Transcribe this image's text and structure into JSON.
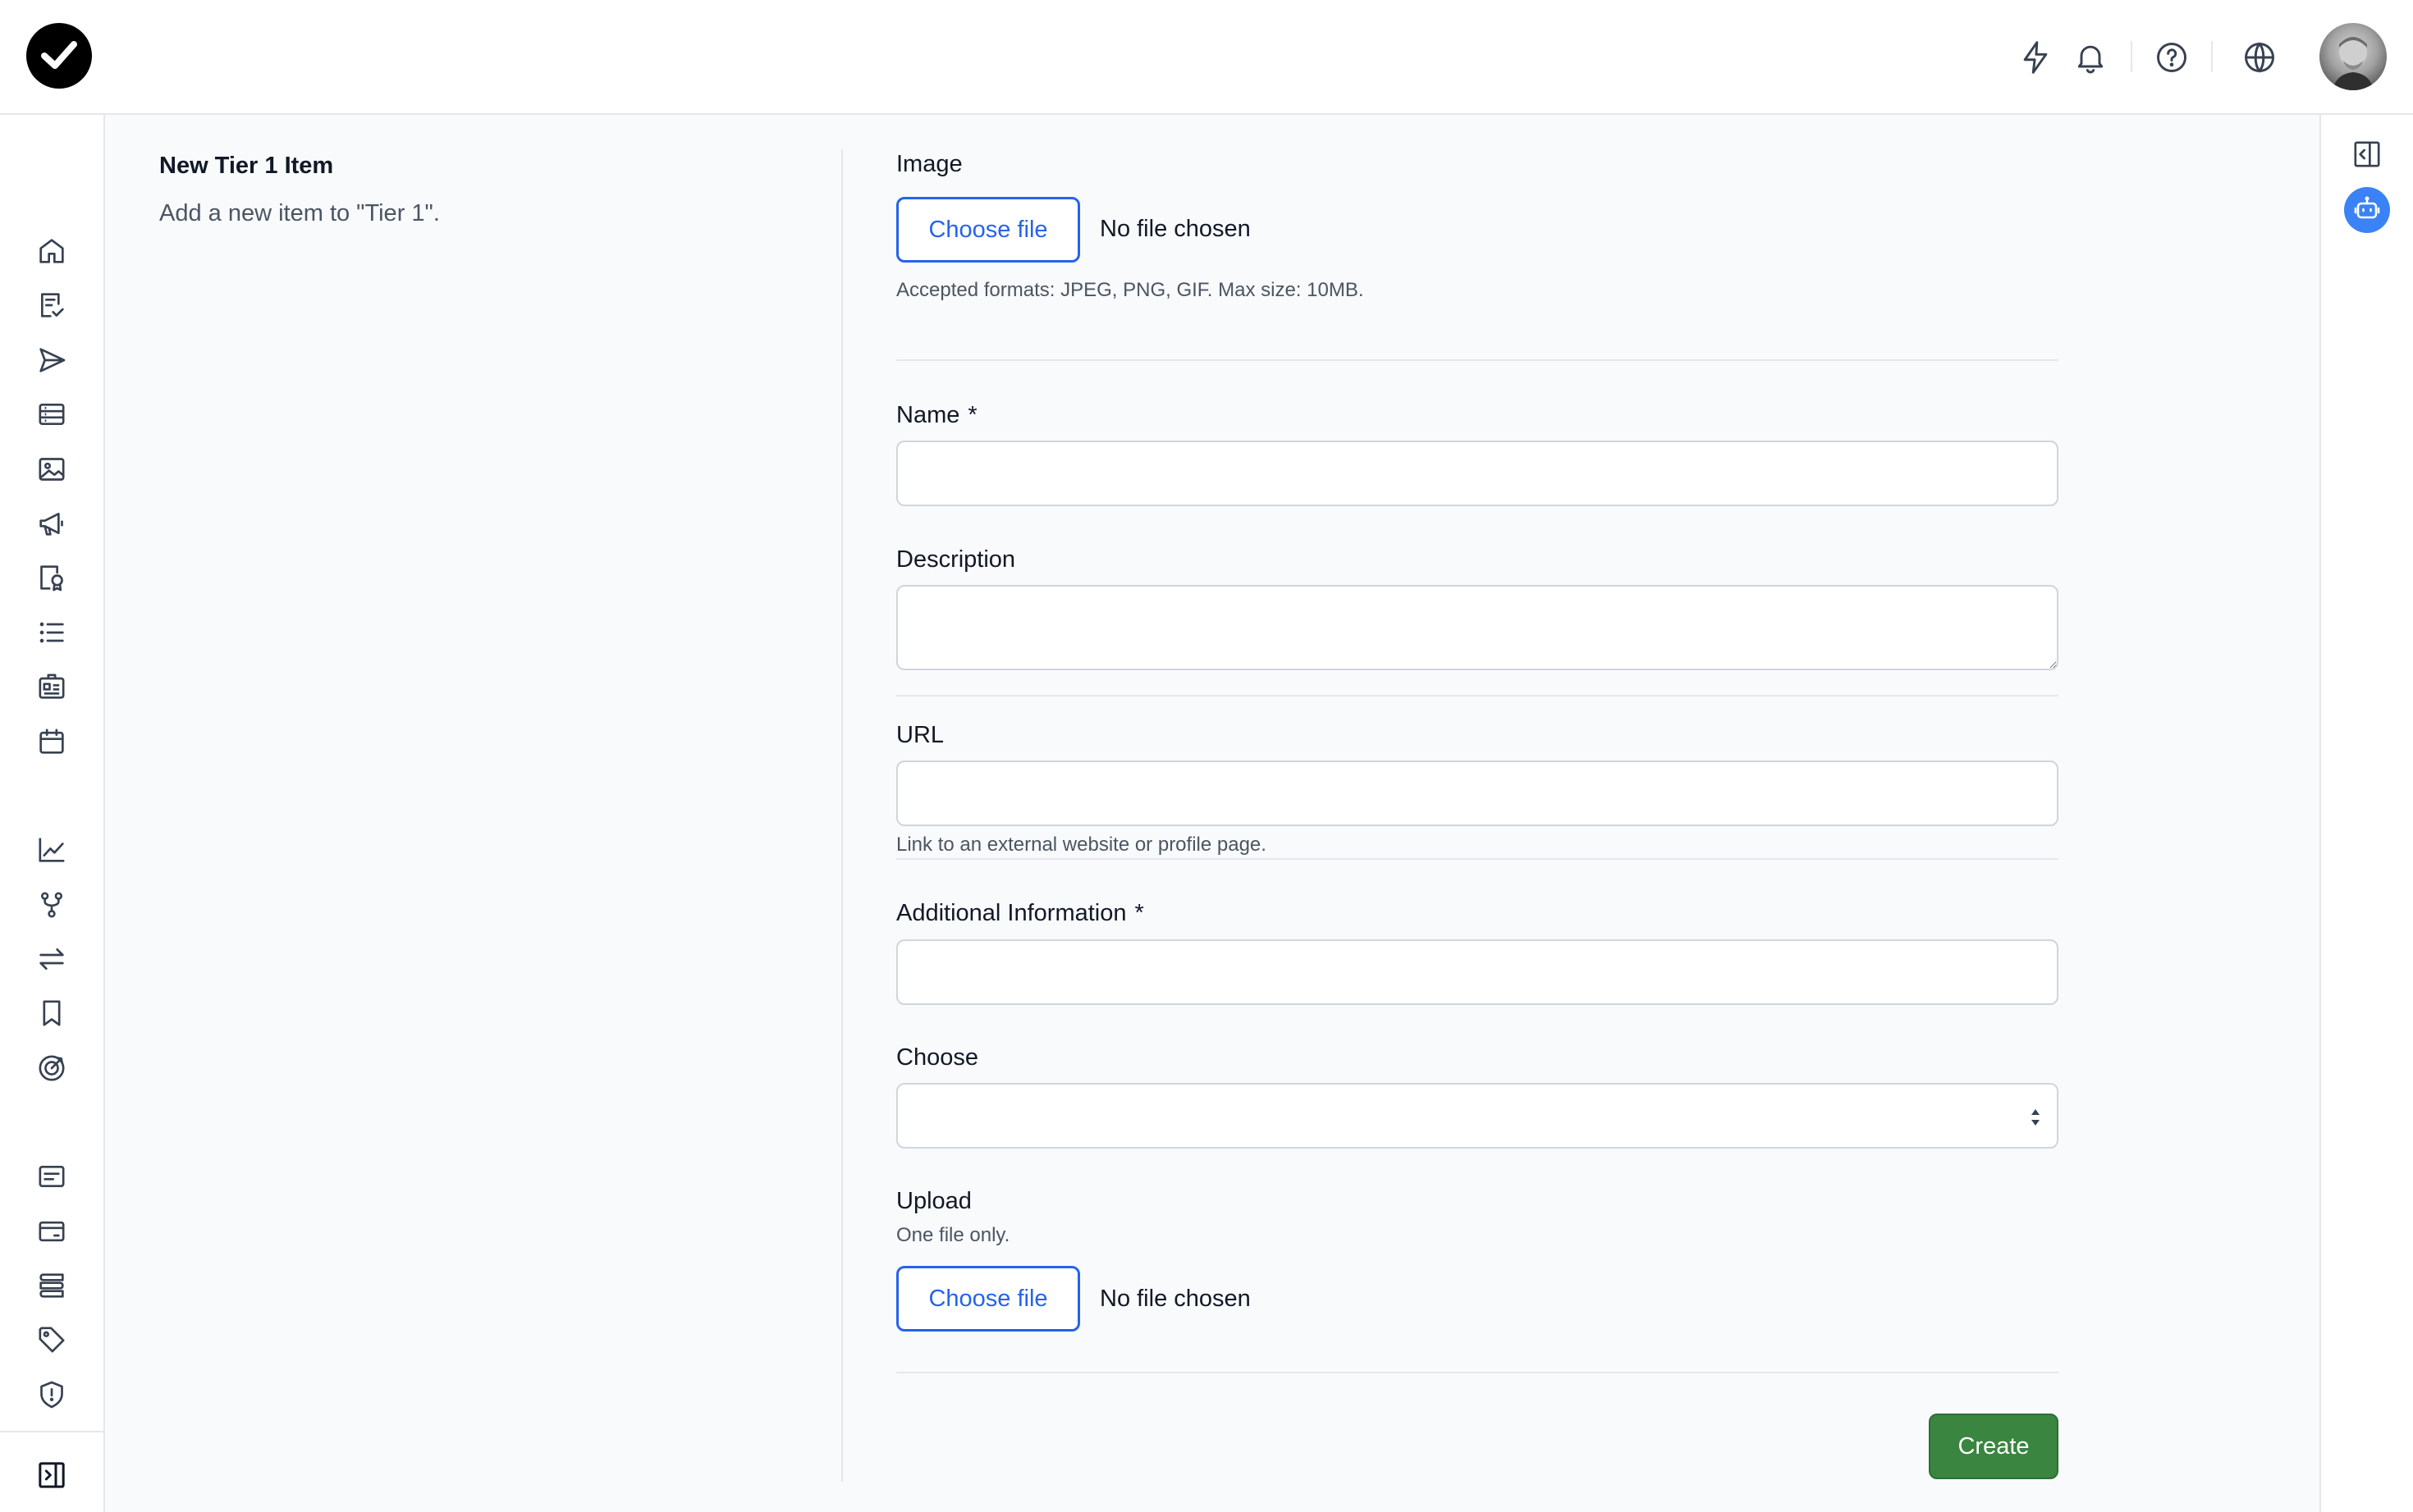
{
  "header": {
    "logo": "checkmark-logo",
    "icons": [
      "lightning-icon",
      "bell-icon",
      "help-icon",
      "globe-icon"
    ],
    "avatar": "user-avatar"
  },
  "sidebar": {
    "icons": [
      "home-icon",
      "checklist-icon",
      "send-icon",
      "table-icon",
      "image-icon",
      "megaphone-icon",
      "document-award-icon",
      "list-icon",
      "id-card-icon",
      "calendar-icon",
      "chart-line-icon",
      "branch-icon",
      "swap-icon",
      "bookmark-icon",
      "target-icon",
      "card-text-icon",
      "credit-card-icon",
      "stack-icon",
      "tag-icon",
      "shield-icon"
    ],
    "collapse_icon": "panel-collapse-icon"
  },
  "right_rail": {
    "panel_icon": "panel-toggle-icon",
    "assistant_icon": "robot-icon"
  },
  "section": {
    "title": "New Tier 1 Item",
    "description": "Add a new item to \"Tier 1\"."
  },
  "form": {
    "image": {
      "label": "Image",
      "button": "Choose file",
      "status": "No file chosen",
      "hint": "Accepted formats: JPEG, PNG, GIF. Max size: 10MB."
    },
    "name": {
      "label": "Name",
      "required": "*",
      "value": ""
    },
    "description": {
      "label": "Description",
      "value": ""
    },
    "url": {
      "label": "URL",
      "value": "",
      "hint": "Link to an external website or profile page."
    },
    "additional": {
      "label": "Additional Information",
      "required": "*",
      "value": ""
    },
    "choose": {
      "label": "Choose",
      "selected": ""
    },
    "upload": {
      "label": "Upload",
      "hint": "One file only.",
      "button": "Choose file",
      "status": "No file chosen"
    },
    "submit": "Create"
  },
  "colors": {
    "accent": "#2563eb",
    "submit": "#3a8540",
    "assistant": "#3b82f6"
  }
}
